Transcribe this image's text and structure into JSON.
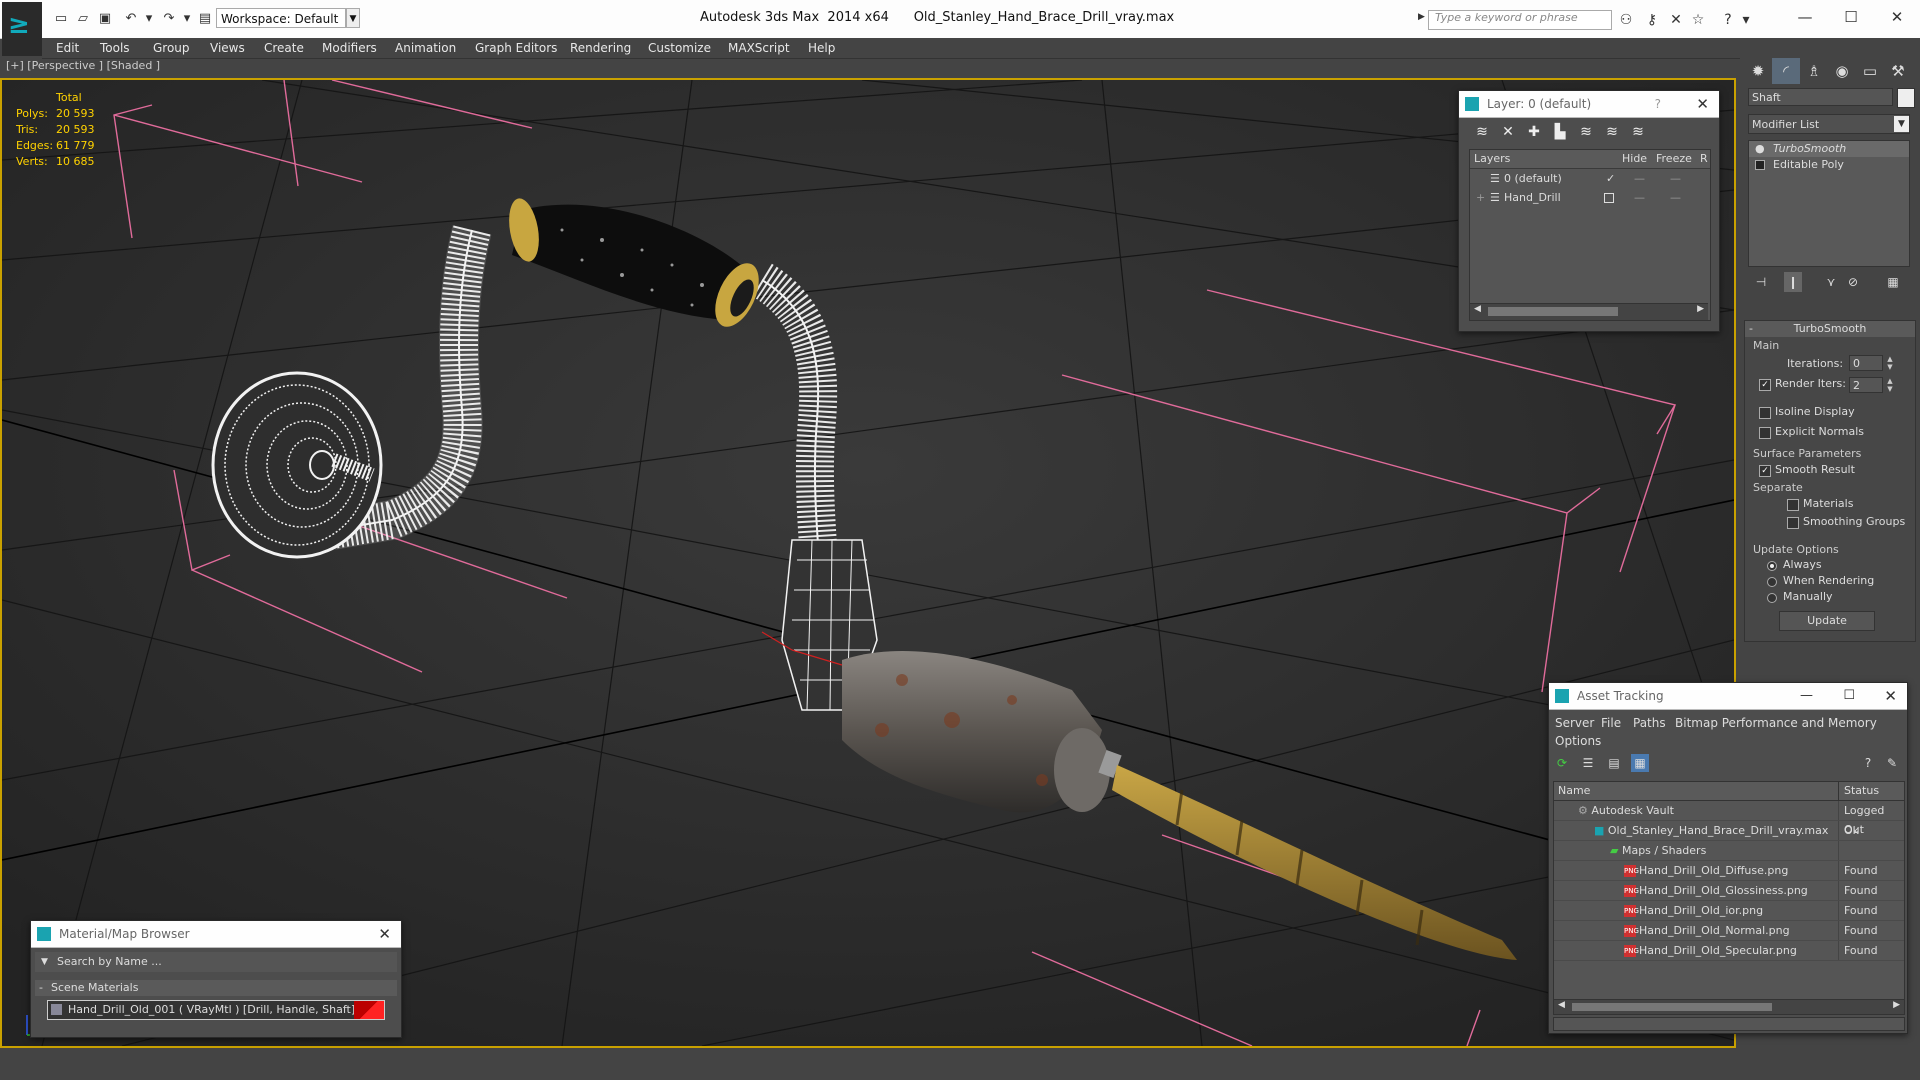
{
  "app": {
    "title": "Autodesk 3ds Max  2014 x64",
    "file": "Old_Stanley_Hand_Brace_Drill_vray.max",
    "workspace": "Workspace: Default",
    "search_placeholder": "Type a keyword or phrase"
  },
  "menu": [
    "Edit",
    "Tools",
    "Group",
    "Views",
    "Create",
    "Modifiers",
    "Animation",
    "Graph Editors",
    "Rendering",
    "Customize",
    "MAXScript",
    "Help"
  ],
  "viewport": {
    "label": "[+] [Perspective ] [Shaded ]",
    "stats_header": "Total",
    "stats": [
      {
        "label": "Polys:",
        "value": "20 593"
      },
      {
        "label": "Tris:",
        "value": "20 593"
      },
      {
        "label": "Edges:",
        "value": "61 779"
      },
      {
        "label": "Verts:",
        "value": "10 685"
      }
    ]
  },
  "layer_panel": {
    "title": "Layer: 0 (default)",
    "help": "?",
    "columns": [
      "Layers",
      "Hide",
      "Freeze",
      "R"
    ],
    "rows": [
      {
        "name": "0 (default)",
        "checked": "✓"
      },
      {
        "name": "Hand_Drill",
        "checked": ""
      }
    ]
  },
  "command_panel": {
    "object_name": "Shaft",
    "modifier_list": "Modifier List",
    "stack": [
      "TurboSmooth",
      "Editable Poly"
    ],
    "turbosmooth": {
      "title": "TurboSmooth",
      "main_label": "Main",
      "iterations_label": "Iterations:",
      "iterations": "0",
      "render_iters_label": "Render Iters:",
      "render_iters": "2",
      "isoline": "Isoline Display",
      "explicit_normals": "Explicit Normals",
      "surface_params": "Surface Parameters",
      "smooth_result": "Smooth Result",
      "separate": "Separate",
      "materials": "Materials",
      "smoothing_groups": "Smoothing Groups",
      "update_options": "Update Options",
      "always": "Always",
      "when_rendering": "When Rendering",
      "manually": "Manually",
      "update_button": "Update"
    }
  },
  "asset_tracking": {
    "title": "Asset Tracking",
    "menu": [
      "Server",
      "File",
      "Paths",
      "Bitmap Performance and Memory",
      "Options"
    ],
    "columns": [
      "Name",
      "Status"
    ],
    "rows": [
      {
        "name": "Autodesk Vault",
        "status": "Logged Out"
      },
      {
        "name": "Old_Stanley_Hand_Brace_Drill_vray.max",
        "status": "Ok"
      },
      {
        "name": "Maps / Shaders",
        "status": ""
      },
      {
        "name": "Hand_Drill_Old_Diffuse.png",
        "status": "Found"
      },
      {
        "name": "Hand_Drill_Old_Glossiness.png",
        "status": "Found"
      },
      {
        "name": "Hand_Drill_Old_ior.png",
        "status": "Found"
      },
      {
        "name": "Hand_Drill_Old_Normal.png",
        "status": "Found"
      },
      {
        "name": "Hand_Drill_Old_Specular.png",
        "status": "Found"
      }
    ],
    "png_badge": "PNG"
  },
  "material_browser": {
    "title": "Material/Map Browser",
    "search_placeholder": "Search by Name ...",
    "group": "Scene Materials",
    "item": "Hand_Drill_Old_001  ( VRayMtl )  [Drill, Handle, Shaft]"
  },
  "colors": {
    "viewport_border": "#c9a100",
    "stats_text": "#ffd200",
    "accent": "#1aa3b0"
  }
}
